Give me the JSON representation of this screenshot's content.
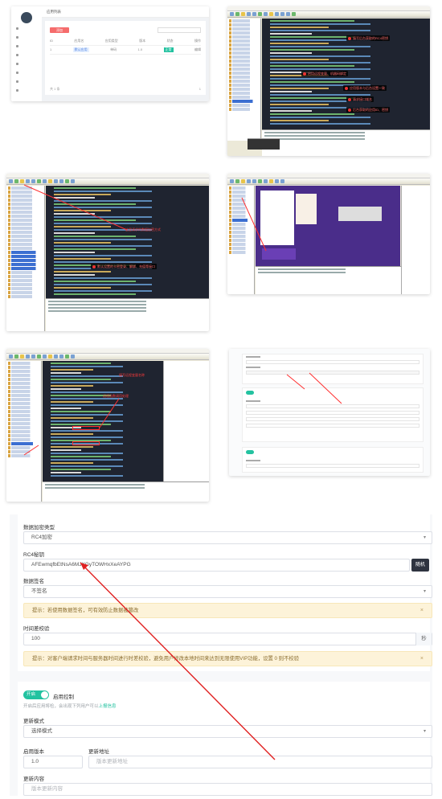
{
  "admin": {
    "header": "应用列表",
    "add_button": "添加",
    "table_headers": [
      "ID",
      "应用名",
      "应用类型",
      "版本",
      "状态",
      "操作"
    ],
    "row": [
      "1",
      "默认应用",
      "单码",
      "1.0",
      "正常",
      "编辑"
    ],
    "footer_left": "共 1 条",
    "footer_right": "1"
  },
  "ide2": {
    "notes": [
      "填写后台获取的RC4密钥",
      "启用远程变量、机器码绑定",
      "应用版本与后台设置一致",
      "请求接口域名",
      "后台获取的应用ID、密钥"
    ]
  },
  "ide3": {
    "notes": [
      "这里请求的数据加密方式",
      "默认设置的卡密登录、解绑、充值等接口"
    ]
  },
  "ide5": {
    "notes": [
      "填写远程变量名称",
      "远程函数调用处理"
    ]
  },
  "form": {
    "encrypt_type": {
      "label": "数据加密类型",
      "value": "RC4加密"
    },
    "rc4_key": {
      "label": "RC4秘钥",
      "value": "AFEwmqfbEtNsA6MJXGyTOWHxXeAYPG",
      "button": "随机"
    },
    "sign": {
      "label": "数据签名",
      "value": "不签名"
    },
    "sign_tip": "提示：若使用数据签名，可有效防止数据被篡改",
    "time_check": {
      "label": "时间差校验",
      "value": "100",
      "unit": "秒"
    },
    "time_tip": "提示：对客户端请求时间与服务器时间进行时差校验，避免用户修改本地时间来达到无限使用VIP功能，设置 0 则不校验",
    "update": {
      "toggle": "开启",
      "title": "启用控制",
      "hint_prefix": "开启后应用将检，会出现下列用户可以",
      "hint_link": "上报信息",
      "mode_label": "更新模式",
      "mode_value": "选择模式",
      "version_label": "启用版本",
      "version_value": "1.0",
      "url_label": "更新地址",
      "url_placeholder": "版本更新地址",
      "content_label": "更新内容",
      "content_placeholder": "版本更新内容"
    }
  },
  "colors": {
    "accent": "#23c2a0",
    "alert_bg": "#fdf3d9",
    "annotation": "#ff3030",
    "code_bg": "#1f2430"
  }
}
